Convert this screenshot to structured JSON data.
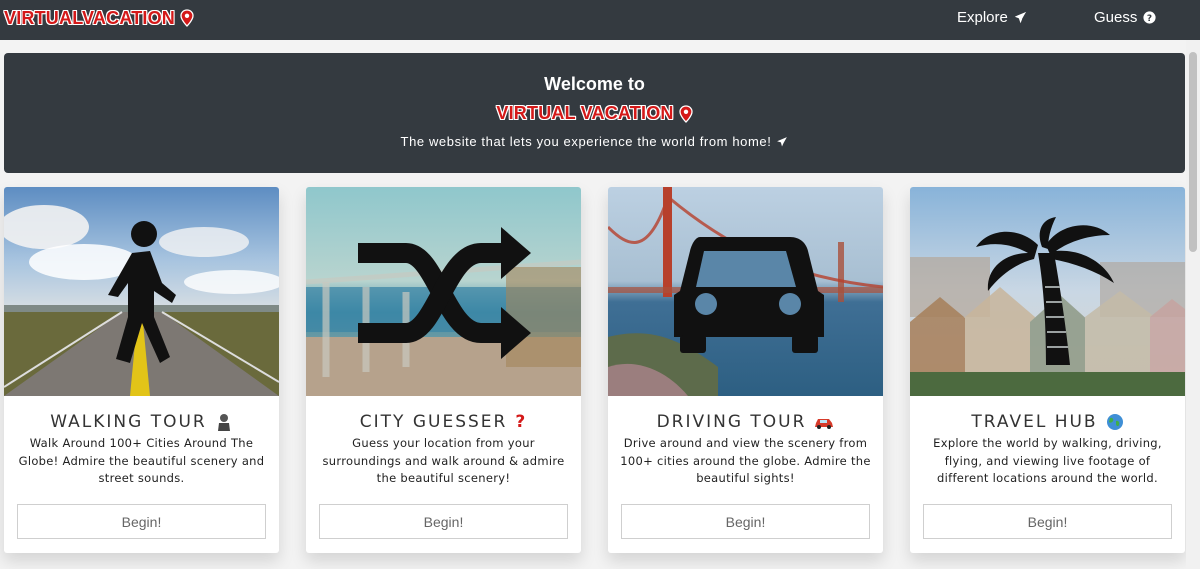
{
  "navbar": {
    "brand": "VIRTUALVACATION",
    "brand_icon": "map-pin-icon",
    "links": [
      {
        "label": "Explore",
        "icon": "plane-icon"
      },
      {
        "label": "Guess",
        "icon": "question-circle-icon"
      }
    ]
  },
  "hero": {
    "welcome": "Welcome to",
    "brand": "VIRTUAL VACATION",
    "subtitle": "The website that lets you experience the world from home!",
    "subtitle_icon": "plane-icon"
  },
  "cards": [
    {
      "title": "WALKING TOUR",
      "emoji": "walking-person-emoji",
      "description": "Walk Around 100+ Cities Around The Globe! Admire the beautiful scenery and street sounds.",
      "button": "Begin!",
      "image_icon": "walking-person-icon"
    },
    {
      "title": "CITY GUESSER",
      "emoji": "question-mark-emoji",
      "description": "Guess your location from your surroundings and walk around & admire the beautiful scenery!",
      "button": "Begin!",
      "image_icon": "shuffle-icon"
    },
    {
      "title": "DRIVING TOUR",
      "emoji": "car-emoji",
      "description": "Drive around and view the scenery from 100+ cities around the globe. Admire the beautiful sights!",
      "button": "Begin!",
      "image_icon": "car-icon"
    },
    {
      "title": "TRAVEL HUB",
      "emoji": "globe-emoji",
      "description": "Explore the world by walking, driving, flying, and viewing live footage of different locations around the world.",
      "button": "Begin!",
      "image_icon": "palm-tree-icon"
    }
  ],
  "colors": {
    "navbar": "#343a40",
    "brand_red": "#d41919",
    "background": "#f3f3f3"
  }
}
